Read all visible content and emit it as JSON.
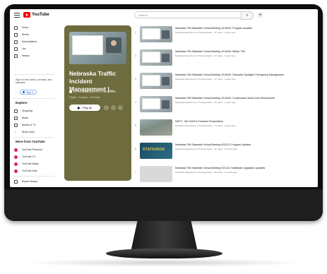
{
  "app": {
    "logo_text": "YouTube",
    "search_placeholder": "Search",
    "brand_color": "#ff0000"
  },
  "sidebar": {
    "items": [
      {
        "label": "Home",
        "icon": "home-icon"
      },
      {
        "label": "Shorts",
        "icon": "shorts-icon"
      },
      {
        "label": "Subscriptions",
        "icon": "subscriptions-icon"
      },
      {
        "label": "You",
        "icon": "you-icon"
      },
      {
        "label": "History",
        "icon": "history-icon"
      }
    ],
    "signin_note": "Sign in to like videos, comment, and subscribe.",
    "signin_label": "Sign in",
    "explore_heading": "Explore",
    "explore_items": [
      {
        "label": "Shopping",
        "icon": "shopping-icon"
      },
      {
        "label": "Music",
        "icon": "music-icon"
      },
      {
        "label": "Movies & TV",
        "icon": "movies-icon"
      },
      {
        "label": "Show more",
        "icon": "chevron-down-icon"
      }
    ],
    "more_heading": "More from YouTube",
    "more_items": [
      {
        "label": "YouTube Premium"
      },
      {
        "label": "YouTube TV"
      },
      {
        "label": "YouTube Music"
      },
      {
        "label": "YouTube Kids"
      }
    ],
    "report_label": "Report history"
  },
  "playlist": {
    "title": "Nebraska Traffic Incident Management |...",
    "owner": "by Nebraska Department of Transportation",
    "meta": "Playlist · 24 videos · 154 views",
    "play_all": "Play all",
    "card_color": "#6e6c3e"
  },
  "videos": [
    {
      "num": "1",
      "title": "Nebraska TIM Statewide Virtual Meeting 12/16/20: Program Updates",
      "sub": "Nebraska Department of Transportation · 71 views · 3 years ago",
      "thumb": "meeting"
    },
    {
      "num": "2",
      "title": "Nebraska TIM Statewide Virtual Meeting 12/16/20: Winter TIM",
      "sub": "Nebraska Department of Transportation · 44 views · 3 years ago",
      "thumb": "meeting"
    },
    {
      "num": "3",
      "title": "Nebraska TIM Statewide Virtual Meeting 12/16/20: Discipline Spotlight: Emergency Management",
      "sub": "Nebraska Department of Transportation · 17 views · 3 years ago",
      "thumb": "meeting"
    },
    {
      "num": "4",
      "title": "Nebraska TIM Statewide Virtual Meeting 12/16/20: Construction Work Zone Enforcement",
      "sub": "Nebraska Department of Transportation · 29 views · 3 years ago",
      "thumb": "meeting"
    },
    {
      "num": "5",
      "title": "NDOT - I80 S41N In Partners Presentation",
      "sub": "Nebraska Department of Transportation · 74 views · 3 years ago",
      "thumb": "aerial"
    },
    {
      "num": "6",
      "title": "Nebraska TIM Statewide Virtual Meeting 9/22/23: Program Updates",
      "sub": "Nebraska Department of Transportation · 31 views · 9 months ago",
      "thumb": "statewide",
      "thumb_text": "STATEWIDE"
    },
    {
      "num": "7",
      "title": "Nebraska TIM Statewide Virtual Meeting 9/21/23: Statewide Legislative Updates",
      "sub": "Nebraska Department of Transportation · 28 views · 9 months ago",
      "thumb": "blank"
    }
  ]
}
